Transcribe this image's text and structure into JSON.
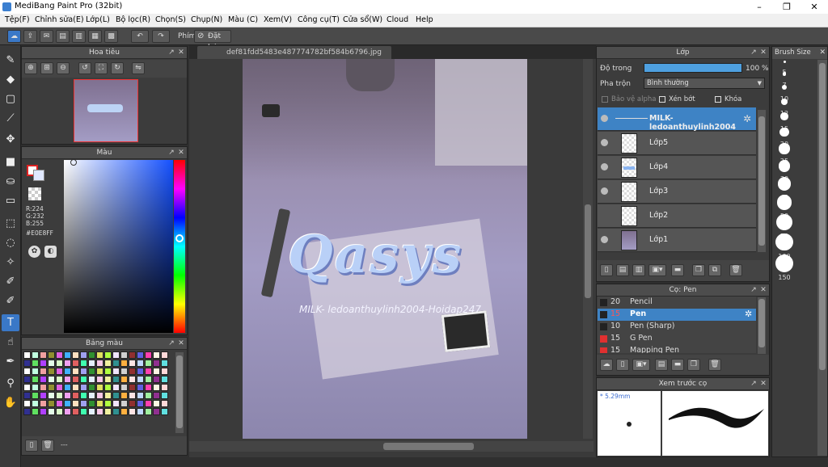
{
  "window": {
    "title": "MediBang Paint Pro (32bit)"
  },
  "menu": [
    "Tệp(F)",
    "Chỉnh sửa(E)",
    "Lớp(L)",
    "Bộ lọc(R)",
    "Chọn(S)",
    "Chụp(N)",
    "Màu (C)",
    "Xem(V)",
    "Công cụ(T)",
    "Cửa sổ(W)",
    "Cloud",
    "Help"
  ],
  "toolbar": {
    "phim_label": "Phím",
    "reset_label": "Đặt lại"
  },
  "canvas": {
    "tab_title": "def81fdd5483e487774782bf584b6796.jpg",
    "logo_text": "Qasys",
    "watermark": "MILK- ledoanthuylinh2004-Hoidap247"
  },
  "navigator": {
    "title": "Hoa tiêu"
  },
  "color_panel": {
    "title": "Màu",
    "rgb": [
      "R:224",
      "G:232",
      "B:255"
    ],
    "hex": "#E0E8FF"
  },
  "palette_panel": {
    "title": "Bảng màu",
    "footer_text": "---"
  },
  "layer_panel": {
    "title": "Lớp",
    "opacity_label": "Độ trong",
    "opacity_value": "100 %",
    "opacity": 1.0,
    "blend_label": "Pha trộn",
    "blend_value": "Bình thường",
    "protect_alpha": "Bảo vệ alpha",
    "clipping": "Xén bớt",
    "lock": "Khóa",
    "layers": [
      {
        "name": "MILK- ledoanthuylinh2004"
      },
      {
        "name": "Lớp5"
      },
      {
        "name": "Lớp4"
      },
      {
        "name": "Lớp3"
      },
      {
        "name": "Lớp2"
      },
      {
        "name": "Lớp1"
      }
    ]
  },
  "brush_panel": {
    "title": "Cọ: Pen",
    "brushes": [
      {
        "size": "20",
        "name": "Pencil",
        "color": "#222222"
      },
      {
        "size": "15",
        "name": "Pen",
        "color": "#222222"
      },
      {
        "size": "10",
        "name": "Pen (Sharp)",
        "color": "#222222"
      },
      {
        "size": "15",
        "name": "G Pen",
        "color": "#e03030"
      },
      {
        "size": "15",
        "name": "Mapping Pen",
        "color": "#e03030"
      }
    ]
  },
  "brush_preview": {
    "title": "Xem trước cọ",
    "size_label": "* 5.29mm"
  },
  "brush_size": {
    "title": "Brush Size",
    "sizes": [
      "5",
      "7",
      "10",
      "12",
      "15",
      "20",
      "25",
      "30",
      "40",
      "50",
      "70",
      "100",
      "150"
    ]
  },
  "colors": {
    "accent": "#3e83c5",
    "panel": "#3c3c3c",
    "current_color": "#E0E8FF"
  }
}
